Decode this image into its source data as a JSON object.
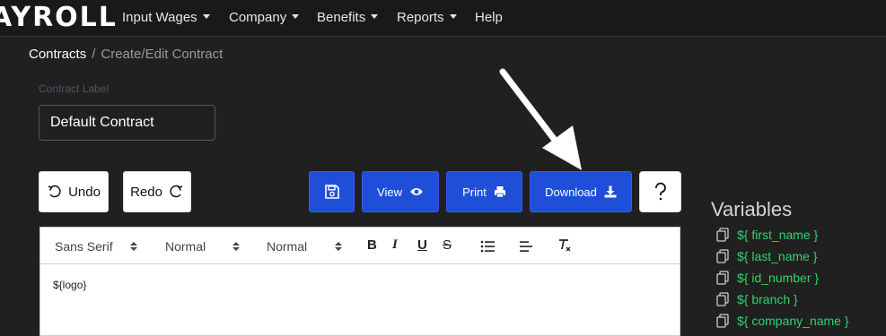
{
  "navbar": {
    "brand": "AYROLL",
    "items": [
      {
        "label": "Input Wages",
        "dropdown": true
      },
      {
        "label": "Company",
        "dropdown": true
      },
      {
        "label": "Benefits",
        "dropdown": true
      },
      {
        "label": "Reports",
        "dropdown": true
      },
      {
        "label": "Help",
        "dropdown": false
      }
    ]
  },
  "breadcrumb": {
    "root": "Contracts",
    "separator": "/",
    "current": "Create/Edit Contract"
  },
  "contract_label": {
    "label": "Contract Label",
    "value": "Default Contract"
  },
  "actions": {
    "undo": "Undo",
    "redo": "Redo",
    "view": "View",
    "print": "Print",
    "download": "Download"
  },
  "toolbar": {
    "font": "Sans Serif",
    "size": "Normal",
    "heading": "Normal",
    "bold": "B",
    "italic": "I",
    "underline": "U",
    "strike": "S"
  },
  "editor": {
    "content": "${logo}"
  },
  "variables": {
    "title": "Variables",
    "items": [
      "${ first_name }",
      "${ last_name }",
      "${ id_number }",
      "${ branch }",
      "${ company_name }"
    ]
  },
  "colors": {
    "background": "#202020",
    "primary": "#1f4fd9",
    "variable": "#2fd46b"
  }
}
